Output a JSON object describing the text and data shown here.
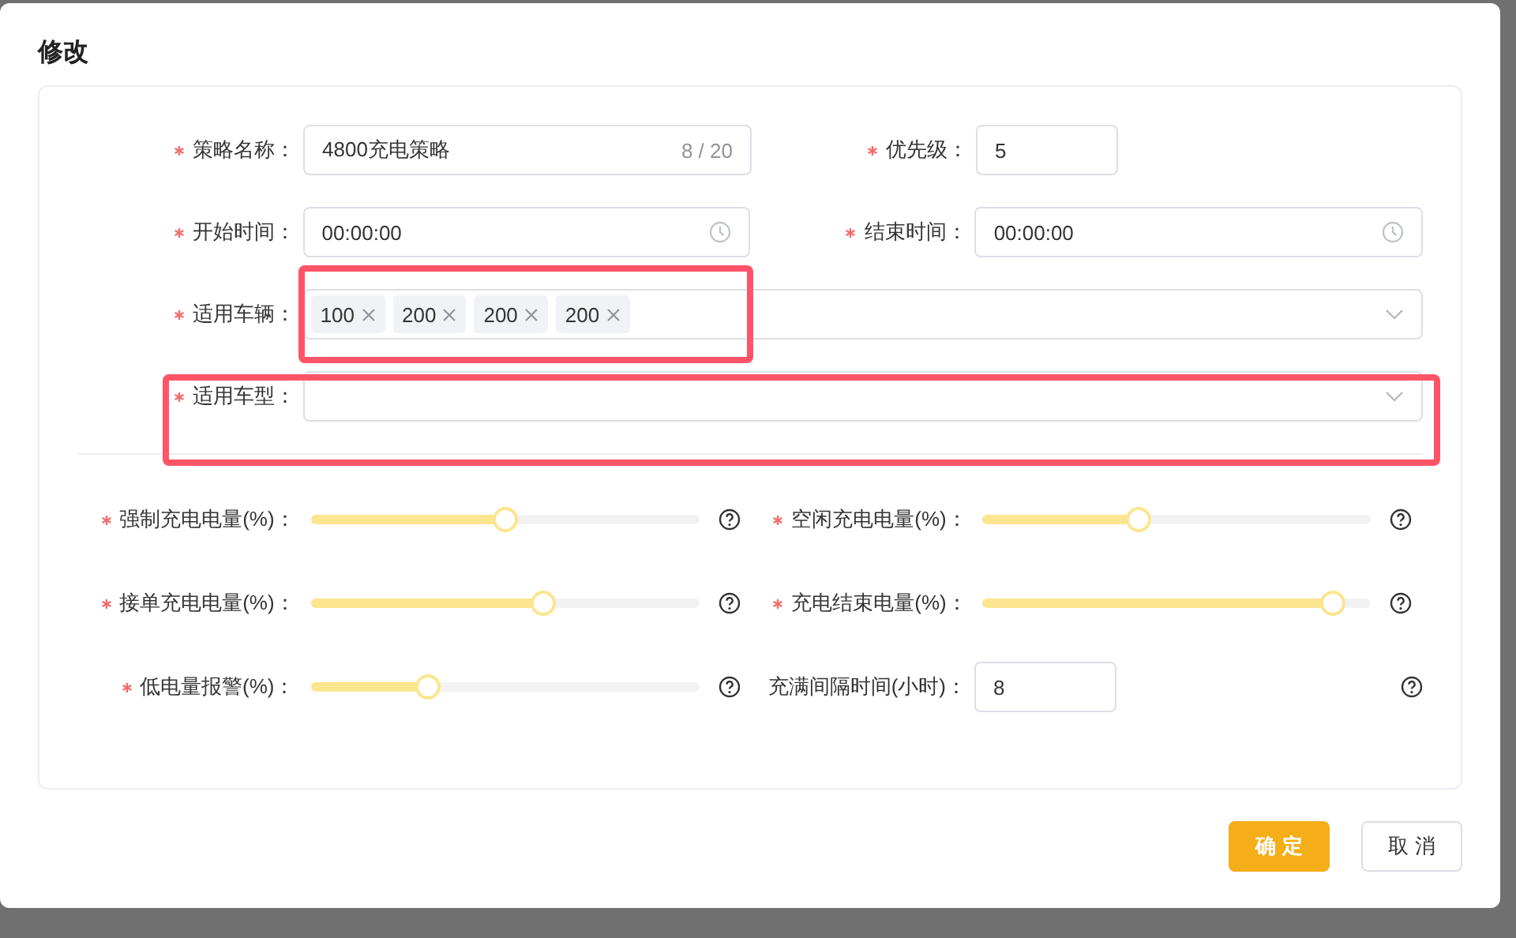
{
  "dialog": {
    "title": "修改",
    "rows": [
      [
        {
          "kind": "text",
          "label": "策略名称：",
          "required": true,
          "value": "4800充电策略",
          "counter": "8 / 20"
        },
        {
          "kind": "number",
          "label": "优先级：",
          "required": true,
          "value": "5"
        }
      ],
      [
        {
          "kind": "time",
          "label": "开始时间：",
          "required": true,
          "value": "00:00:00"
        },
        {
          "kind": "time",
          "label": "结束时间：",
          "required": true,
          "value": "00:00:00"
        }
      ],
      [
        {
          "kind": "tags",
          "label": "适用车辆：",
          "required": true,
          "tags": [
            "100",
            "200",
            "200",
            "200"
          ],
          "highlighted": true
        }
      ],
      [
        {
          "kind": "select",
          "label": "适用车型：",
          "required": true,
          "highlighted": true
        }
      ]
    ],
    "slider_rows": [
      [
        {
          "kind": "slider",
          "label": "强制充电电量(%)：",
          "required": true,
          "level": 0.5,
          "help": true
        },
        {
          "kind": "slider",
          "label": "空闲充电电量(%)：",
          "required": true,
          "level": 0.4,
          "help": true
        }
      ],
      [
        {
          "kind": "slider",
          "label": "接单充电电量(%)：",
          "required": true,
          "level": 0.6,
          "help": true
        },
        {
          "kind": "slider",
          "label": "充电结束电量(%)：",
          "required": true,
          "level": 0.9,
          "help": true
        }
      ],
      [
        {
          "kind": "slider",
          "label": "低电量报警(%)：",
          "required": true,
          "level": 0.3,
          "help": true
        },
        {
          "kind": "number",
          "label": "充满间隔时间(小时)：",
          "required": false,
          "value": "8",
          "help": true
        }
      ]
    ],
    "buttons": [
      {
        "label": "确 定",
        "kind": "primary"
      },
      {
        "label": "取 消",
        "kind": "default"
      }
    ]
  }
}
